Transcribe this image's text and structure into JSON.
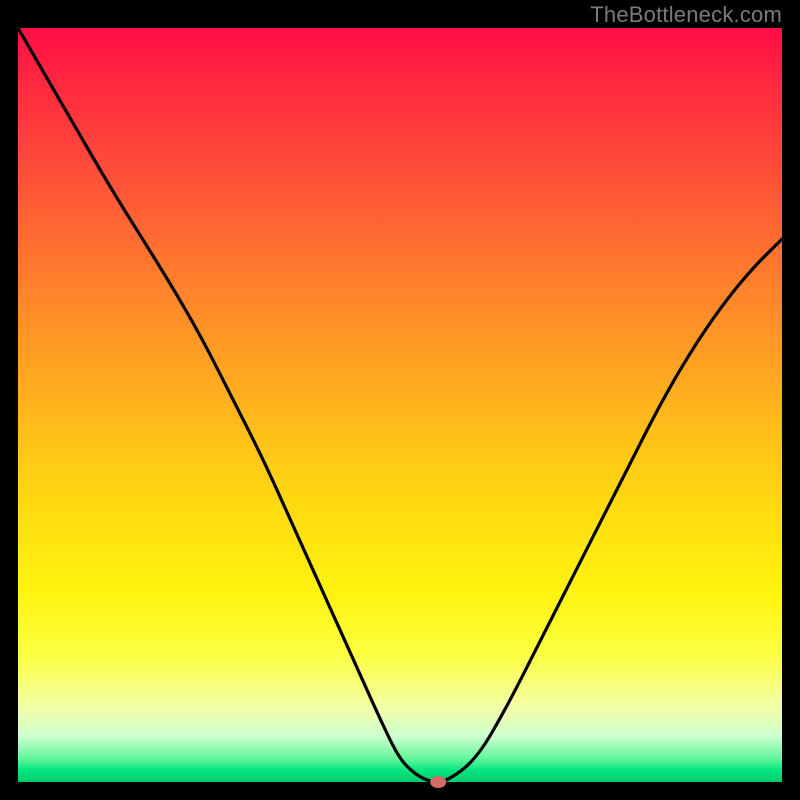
{
  "watermark": "TheBottleneck.com",
  "chart_data": {
    "type": "line",
    "title": "",
    "xlabel": "",
    "ylabel": "",
    "xlim": [
      0,
      100
    ],
    "ylim": [
      0,
      100
    ],
    "grid": false,
    "legend": false,
    "background_gradient": {
      "top": "#ff0d46",
      "mid": "#ffde10",
      "bottom": "#00c96c"
    },
    "series": [
      {
        "name": "bottleneck-curve",
        "x": [
          0,
          4,
          8,
          12,
          16,
          20,
          24,
          28,
          32,
          36,
          40,
          44,
          48,
          50,
          52,
          54,
          56,
          60,
          64,
          68,
          72,
          76,
          80,
          84,
          88,
          92,
          96,
          100
        ],
        "values": [
          100,
          93,
          86,
          79,
          72.5,
          66,
          59,
          51,
          43,
          34,
          25,
          16,
          7,
          3,
          1,
          0,
          0,
          3,
          10,
          18,
          26,
          34,
          42,
          50,
          57,
          63,
          68,
          72
        ]
      }
    ],
    "marker": {
      "x": 55,
      "y": 0,
      "color": "#d46a6a"
    }
  }
}
